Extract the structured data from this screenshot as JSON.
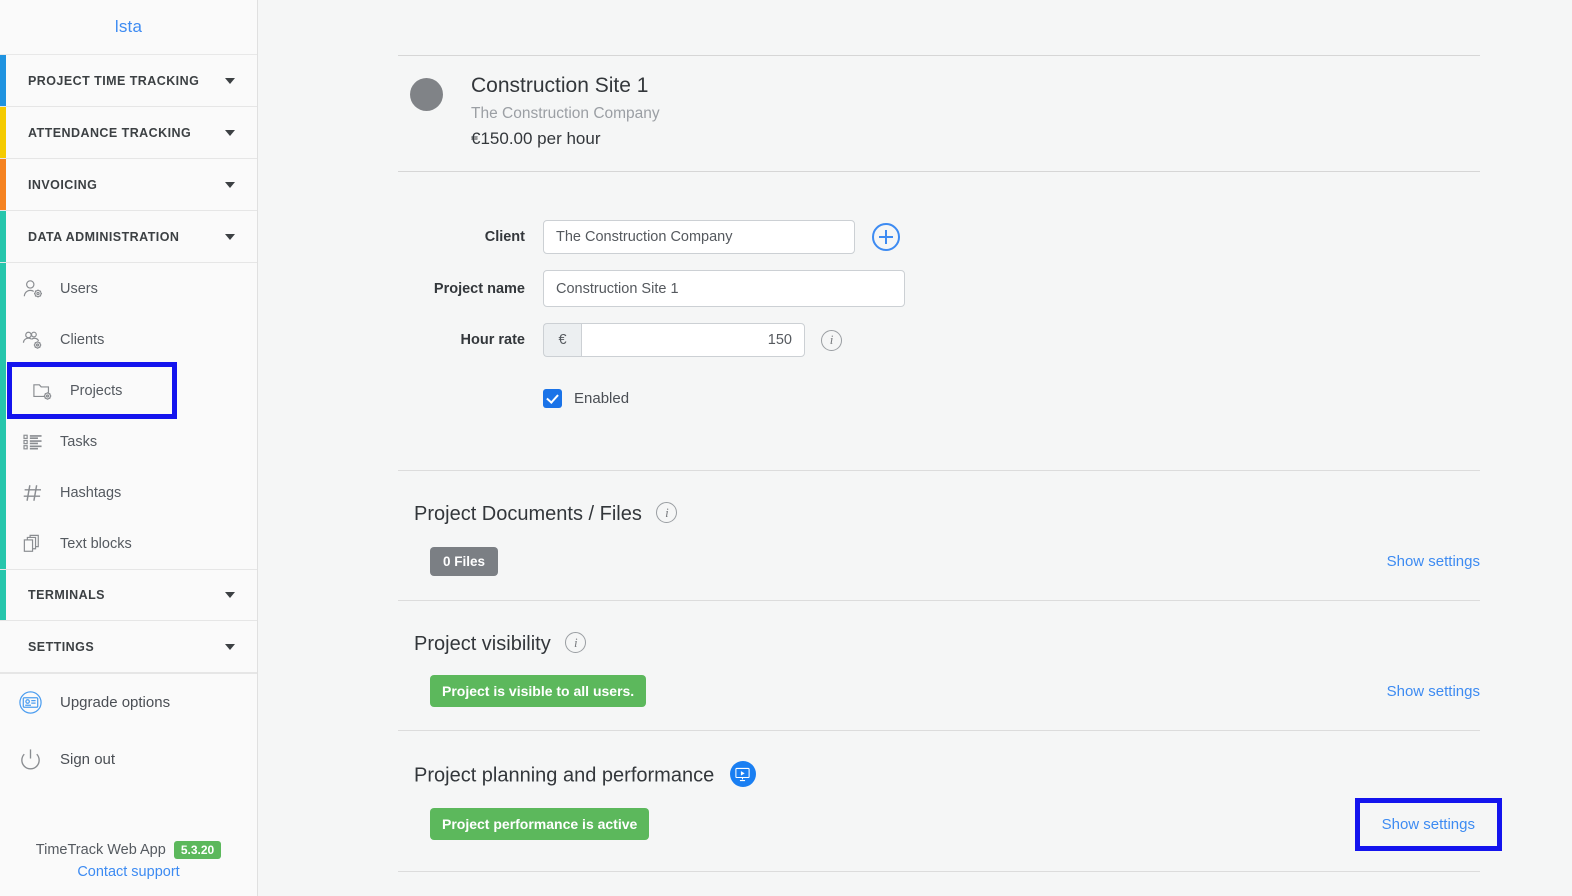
{
  "sidebar": {
    "brand": "lsta",
    "sections": [
      {
        "label": "PROJECT TIME TRACKING",
        "color": "#1f93e0"
      },
      {
        "label": "ATTENDANCE TRACKING",
        "color": "#f5cb00"
      },
      {
        "label": "INVOICING",
        "color": "#f58220"
      },
      {
        "label": "DATA ADMINISTRATION",
        "color": "#26c6ac"
      }
    ],
    "data_admin_items": [
      {
        "label": "Users",
        "icon": "user-gear-icon"
      },
      {
        "label": "Clients",
        "icon": "users-gear-icon"
      },
      {
        "label": "Projects",
        "icon": "folder-gear-icon"
      },
      {
        "label": "Tasks",
        "icon": "list-icon"
      },
      {
        "label": "Hashtags",
        "icon": "hashtag-icon"
      },
      {
        "label": "Text blocks",
        "icon": "copy-icon"
      }
    ],
    "terminals_label": "TERMINALS",
    "settings_label": "SETTINGS",
    "lower_items": [
      {
        "label": "Upgrade options",
        "icon": "upgrade-icon"
      },
      {
        "label": "Sign out",
        "icon": "power-icon"
      }
    ],
    "footer": {
      "app_name": "TimeTrack Web App",
      "version": "5.3.20",
      "support_link": "Contact support"
    }
  },
  "project": {
    "title": "Construction Site 1",
    "client": "The Construction Company",
    "rate_display": "€150.00 per hour"
  },
  "form": {
    "client_label": "Client",
    "client_value": "The Construction Company",
    "project_name_label": "Project name",
    "project_name_value": "Construction Site 1",
    "hour_rate_label": "Hour rate",
    "currency_symbol": "€",
    "hour_rate_value": "150",
    "enabled_label": "Enabled",
    "add_client_icon": "plus-circle-icon",
    "info_icon": "info-icon"
  },
  "sections": {
    "documents": {
      "title": "Project Documents / Files",
      "badge": "0 Files",
      "link": "Show settings",
      "info_icon": "info-icon"
    },
    "visibility": {
      "title": "Project visibility",
      "badge": "Project is visible to all users.",
      "link": "Show settings",
      "info_icon": "info-icon"
    },
    "planning": {
      "title": "Project planning and performance",
      "badge": "Project performance is active",
      "link": "Show settings",
      "video_icon": "video-monitor-icon"
    }
  },
  "colors": {
    "accent_blue": "#3d8bf2",
    "green_badge": "#5cb85c",
    "gray_badge": "#7b7f84",
    "highlight_box": "#1414ee"
  }
}
